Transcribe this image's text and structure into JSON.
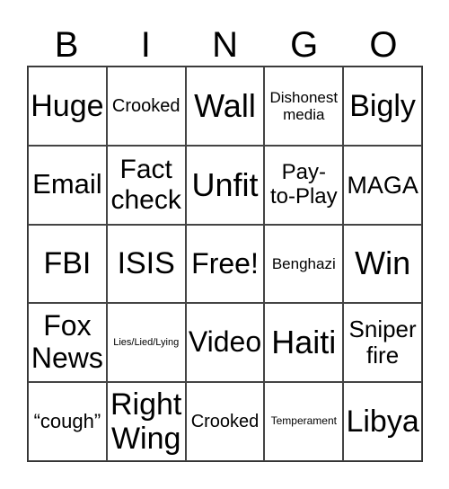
{
  "header": [
    "B",
    "I",
    "N",
    "G",
    "O"
  ],
  "cells": [
    "Huge",
    "Crooked",
    "Wall",
    "Dishonest\nmedia",
    "Bigly",
    "Email",
    "Fact\ncheck",
    "Unfit",
    "Pay-\nto-Play",
    "MAGA",
    "FBI",
    "ISIS",
    "Free!",
    "Benghazi",
    "Win",
    "Fox\nNews",
    "Lies/Lied/Lying",
    "Video",
    "Haiti",
    "Sniper\nfire",
    "“cough”",
    "Right\nWing",
    "Crooked",
    "Temperament",
    "Libya"
  ]
}
